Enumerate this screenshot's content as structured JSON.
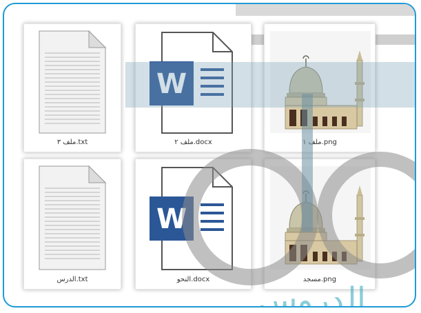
{
  "window": {
    "border_color": "#1d9ad6"
  },
  "files": [
    {
      "name": "ملف ١.png",
      "type": "image",
      "icon": "mosque-image-icon"
    },
    {
      "name": "ملف ٢.docx",
      "type": "word",
      "icon": "word-document-icon"
    },
    {
      "name": "ملف ٣.txt",
      "type": "text",
      "icon": "text-document-icon"
    },
    {
      "name": "مسجد.png",
      "type": "image",
      "icon": "mosque-image-icon"
    },
    {
      "name": "النحو.docx",
      "type": "word",
      "icon": "word-document-icon"
    },
    {
      "name": "الدرس.txt",
      "type": "text",
      "icon": "text-document-icon"
    }
  ],
  "watermark": {
    "text": "الدروس"
  }
}
